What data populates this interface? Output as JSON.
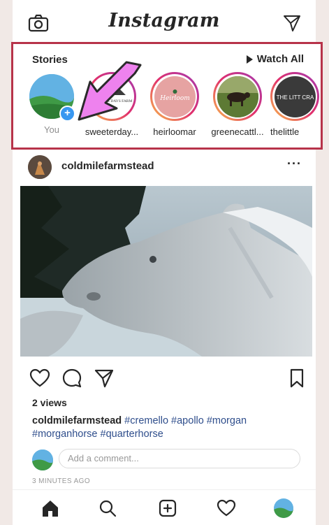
{
  "app": {
    "brand": "Instagram"
  },
  "icons": {
    "camera": "camera-icon",
    "direct": "paper-plane-icon",
    "more": "more-horizontal-icon",
    "like": "heart-icon",
    "comment": "comment-bubble-icon",
    "share": "paper-plane-icon",
    "save": "bookmark-icon",
    "home": "home-icon",
    "search": "search-icon",
    "add": "add-post-icon",
    "activity": "heart-icon",
    "profile": "avatar"
  },
  "colors": {
    "highlight_border": "#b7334a",
    "arrow": "#ee82ee",
    "hashtag": "#2f4e8c",
    "story_ring_start": "#f9c04a",
    "story_ring_end": "#a13ab4",
    "badge": "#3897f0"
  },
  "stories": {
    "title": "Stories",
    "watch_all": "Watch All",
    "items": [
      {
        "label": "You",
        "pic_text": ""
      },
      {
        "label": "sweeterday...",
        "pic_text": "SWEETER DAYS FARM"
      },
      {
        "label": "heirloomar",
        "pic_text": "Heirloom"
      },
      {
        "label": "greenecattl...",
        "pic_text": ""
      },
      {
        "label": "thelittle",
        "pic_text": "THE LITT CRA"
      }
    ]
  },
  "post": {
    "username": "coldmilefarmstead",
    "more": "···",
    "views": "2 views",
    "caption_user": "coldmilefarmstead",
    "hashtags_line1": "#cremello #apollo #morgan",
    "hashtags_line2": "#morganhorse #quarterhorse",
    "comment_placeholder": "Add a comment...",
    "timestamp": "3 MINUTES AGO"
  }
}
